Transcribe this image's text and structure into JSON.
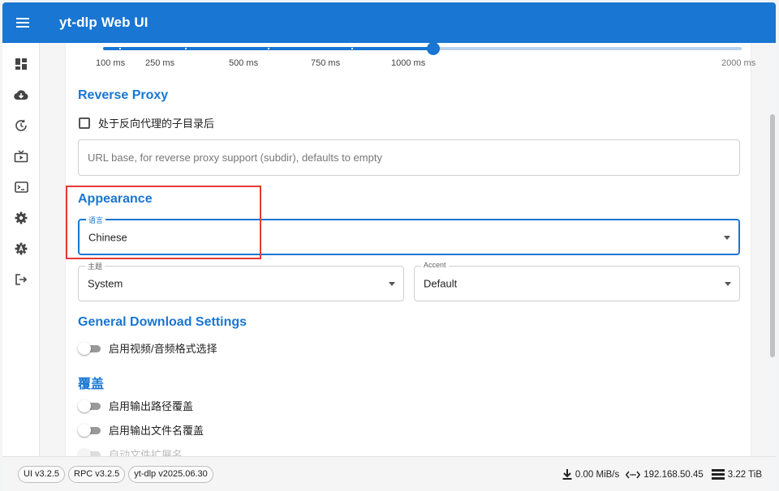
{
  "app": {
    "title": "yt-dlp Web UI"
  },
  "sidebar": {
    "items": [
      {
        "icon": "dashboard-icon"
      },
      {
        "icon": "cloud-download-icon"
      },
      {
        "icon": "history-icon"
      },
      {
        "icon": "live-tv-icon"
      },
      {
        "icon": "terminal-icon"
      },
      {
        "icon": "settings-icon"
      },
      {
        "icon": "settings-suggest-icon"
      },
      {
        "icon": "logout-icon"
      }
    ]
  },
  "slider": {
    "ticks": [
      "100 ms",
      "250 ms",
      "500 ms",
      "750 ms",
      "1000 ms",
      "2000 ms"
    ],
    "value_ms": 1000,
    "min_ms": 0,
    "max_ms": 2000
  },
  "reverse_proxy": {
    "title": "Reverse Proxy",
    "checkbox_label": "处于反向代理的子目录后",
    "checkbox_checked": false,
    "url_placeholder": "URL base, for reverse proxy support (subdir), defaults to empty"
  },
  "appearance": {
    "title": "Appearance",
    "language_label": "语言",
    "language_value": "Chinese",
    "theme_label": "主题",
    "theme_value": "System",
    "accent_label": "Accent",
    "accent_value": "Default"
  },
  "general": {
    "title": "General Download Settings",
    "format_selection_label": "启用视频/音频格式选择",
    "format_selection_on": false
  },
  "overrides": {
    "title": "覆盖",
    "output_path_label": "启用输出路径覆盖",
    "output_path_on": false,
    "output_filename_label": "启用输出文件名覆盖",
    "output_filename_on": false,
    "auto_extension_label": "自动文件扩展名",
    "auto_extension_disabled": true
  },
  "footer": {
    "chips": [
      "UI v3.2.5",
      "RPC v3.2.5",
      "yt-dlp v2025.06.30"
    ],
    "download_speed": "0.00 MiB/s",
    "ip_address": "192.168.50.45",
    "storage": "3.22 TiB"
  },
  "colors": {
    "primary": "#1976d2",
    "highlight_border": "#e53935"
  }
}
